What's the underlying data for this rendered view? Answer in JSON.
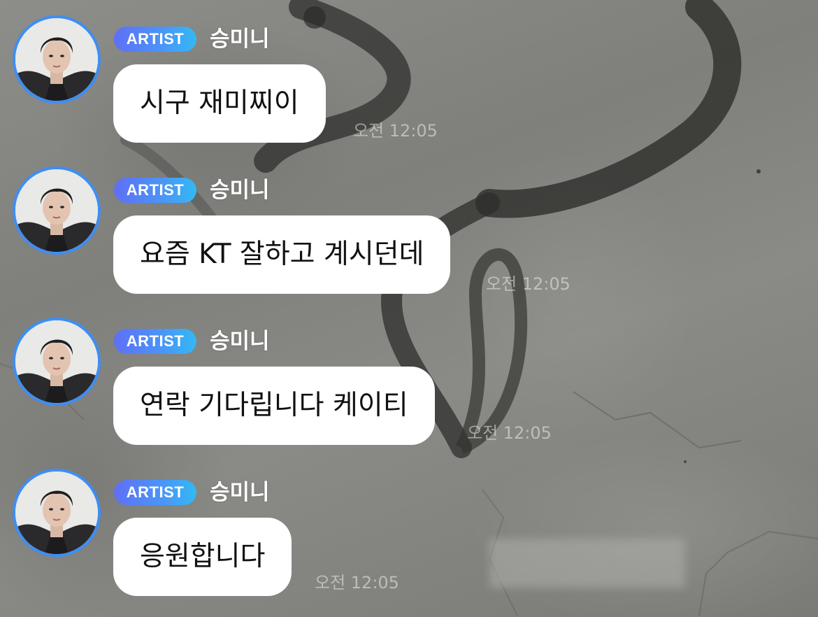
{
  "theme": {
    "badge_gradient": [
      "#5f6ff6",
      "#4a96f7",
      "#33b9f4"
    ],
    "avatar_ring": "#3d8ef4",
    "bubble_bg": "#ffffff"
  },
  "messages": [
    {
      "badge": "ARTIST",
      "sender": "승미니",
      "text": "시구 재미찌이",
      "time": "오전 12:05",
      "avatar_icon": "profile-photo"
    },
    {
      "badge": "ARTIST",
      "sender": "승미니",
      "text": "요즘 KT 잘하고 계시던데",
      "time": "오전 12:05",
      "avatar_icon": "profile-photo"
    },
    {
      "badge": "ARTIST",
      "sender": "승미니",
      "text": "연락 기다립니다 케이티",
      "time": "오전 12:05",
      "avatar_icon": "profile-photo"
    },
    {
      "badge": "ARTIST",
      "sender": "승미니",
      "text": "응원합니다",
      "time": "오전 12:05",
      "avatar_icon": "profile-photo"
    }
  ]
}
